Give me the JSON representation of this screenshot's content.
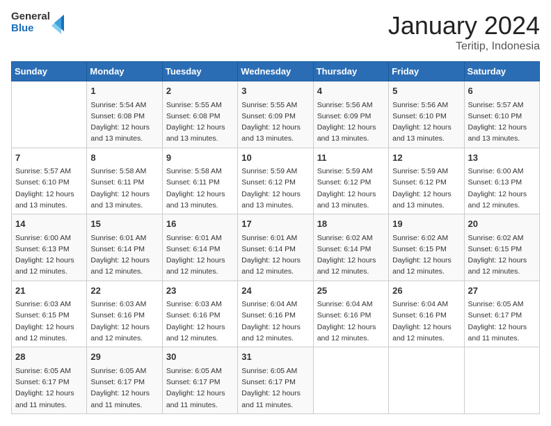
{
  "header": {
    "logo_general": "General",
    "logo_blue": "Blue",
    "month_title": "January 2024",
    "location": "Teritip, Indonesia"
  },
  "days_of_week": [
    "Sunday",
    "Monday",
    "Tuesday",
    "Wednesday",
    "Thursday",
    "Friday",
    "Saturday"
  ],
  "weeks": [
    [
      {
        "day": "",
        "sunrise": "",
        "sunset": "",
        "daylight": ""
      },
      {
        "day": "1",
        "sunrise": "Sunrise: 5:54 AM",
        "sunset": "Sunset: 6:08 PM",
        "daylight": "Daylight: 12 hours and 13 minutes."
      },
      {
        "day": "2",
        "sunrise": "Sunrise: 5:55 AM",
        "sunset": "Sunset: 6:08 PM",
        "daylight": "Daylight: 12 hours and 13 minutes."
      },
      {
        "day": "3",
        "sunrise": "Sunrise: 5:55 AM",
        "sunset": "Sunset: 6:09 PM",
        "daylight": "Daylight: 12 hours and 13 minutes."
      },
      {
        "day": "4",
        "sunrise": "Sunrise: 5:56 AM",
        "sunset": "Sunset: 6:09 PM",
        "daylight": "Daylight: 12 hours and 13 minutes."
      },
      {
        "day": "5",
        "sunrise": "Sunrise: 5:56 AM",
        "sunset": "Sunset: 6:10 PM",
        "daylight": "Daylight: 12 hours and 13 minutes."
      },
      {
        "day": "6",
        "sunrise": "Sunrise: 5:57 AM",
        "sunset": "Sunset: 6:10 PM",
        "daylight": "Daylight: 12 hours and 13 minutes."
      }
    ],
    [
      {
        "day": "7",
        "sunrise": "Sunrise: 5:57 AM",
        "sunset": "Sunset: 6:10 PM",
        "daylight": "Daylight: 12 hours and 13 minutes."
      },
      {
        "day": "8",
        "sunrise": "Sunrise: 5:58 AM",
        "sunset": "Sunset: 6:11 PM",
        "daylight": "Daylight: 12 hours and 13 minutes."
      },
      {
        "day": "9",
        "sunrise": "Sunrise: 5:58 AM",
        "sunset": "Sunset: 6:11 PM",
        "daylight": "Daylight: 12 hours and 13 minutes."
      },
      {
        "day": "10",
        "sunrise": "Sunrise: 5:59 AM",
        "sunset": "Sunset: 6:12 PM",
        "daylight": "Daylight: 12 hours and 13 minutes."
      },
      {
        "day": "11",
        "sunrise": "Sunrise: 5:59 AM",
        "sunset": "Sunset: 6:12 PM",
        "daylight": "Daylight: 12 hours and 13 minutes."
      },
      {
        "day": "12",
        "sunrise": "Sunrise: 5:59 AM",
        "sunset": "Sunset: 6:12 PM",
        "daylight": "Daylight: 12 hours and 13 minutes."
      },
      {
        "day": "13",
        "sunrise": "Sunrise: 6:00 AM",
        "sunset": "Sunset: 6:13 PM",
        "daylight": "Daylight: 12 hours and 12 minutes."
      }
    ],
    [
      {
        "day": "14",
        "sunrise": "Sunrise: 6:00 AM",
        "sunset": "Sunset: 6:13 PM",
        "daylight": "Daylight: 12 hours and 12 minutes."
      },
      {
        "day": "15",
        "sunrise": "Sunrise: 6:01 AM",
        "sunset": "Sunset: 6:14 PM",
        "daylight": "Daylight: 12 hours and 12 minutes."
      },
      {
        "day": "16",
        "sunrise": "Sunrise: 6:01 AM",
        "sunset": "Sunset: 6:14 PM",
        "daylight": "Daylight: 12 hours and 12 minutes."
      },
      {
        "day": "17",
        "sunrise": "Sunrise: 6:01 AM",
        "sunset": "Sunset: 6:14 PM",
        "daylight": "Daylight: 12 hours and 12 minutes."
      },
      {
        "day": "18",
        "sunrise": "Sunrise: 6:02 AM",
        "sunset": "Sunset: 6:14 PM",
        "daylight": "Daylight: 12 hours and 12 minutes."
      },
      {
        "day": "19",
        "sunrise": "Sunrise: 6:02 AM",
        "sunset": "Sunset: 6:15 PM",
        "daylight": "Daylight: 12 hours and 12 minutes."
      },
      {
        "day": "20",
        "sunrise": "Sunrise: 6:02 AM",
        "sunset": "Sunset: 6:15 PM",
        "daylight": "Daylight: 12 hours and 12 minutes."
      }
    ],
    [
      {
        "day": "21",
        "sunrise": "Sunrise: 6:03 AM",
        "sunset": "Sunset: 6:15 PM",
        "daylight": "Daylight: 12 hours and 12 minutes."
      },
      {
        "day": "22",
        "sunrise": "Sunrise: 6:03 AM",
        "sunset": "Sunset: 6:16 PM",
        "daylight": "Daylight: 12 hours and 12 minutes."
      },
      {
        "day": "23",
        "sunrise": "Sunrise: 6:03 AM",
        "sunset": "Sunset: 6:16 PM",
        "daylight": "Daylight: 12 hours and 12 minutes."
      },
      {
        "day": "24",
        "sunrise": "Sunrise: 6:04 AM",
        "sunset": "Sunset: 6:16 PM",
        "daylight": "Daylight: 12 hours and 12 minutes."
      },
      {
        "day": "25",
        "sunrise": "Sunrise: 6:04 AM",
        "sunset": "Sunset: 6:16 PM",
        "daylight": "Daylight: 12 hours and 12 minutes."
      },
      {
        "day": "26",
        "sunrise": "Sunrise: 6:04 AM",
        "sunset": "Sunset: 6:16 PM",
        "daylight": "Daylight: 12 hours and 12 minutes."
      },
      {
        "day": "27",
        "sunrise": "Sunrise: 6:05 AM",
        "sunset": "Sunset: 6:17 PM",
        "daylight": "Daylight: 12 hours and 11 minutes."
      }
    ],
    [
      {
        "day": "28",
        "sunrise": "Sunrise: 6:05 AM",
        "sunset": "Sunset: 6:17 PM",
        "daylight": "Daylight: 12 hours and 11 minutes."
      },
      {
        "day": "29",
        "sunrise": "Sunrise: 6:05 AM",
        "sunset": "Sunset: 6:17 PM",
        "daylight": "Daylight: 12 hours and 11 minutes."
      },
      {
        "day": "30",
        "sunrise": "Sunrise: 6:05 AM",
        "sunset": "Sunset: 6:17 PM",
        "daylight": "Daylight: 12 hours and 11 minutes."
      },
      {
        "day": "31",
        "sunrise": "Sunrise: 6:05 AM",
        "sunset": "Sunset: 6:17 PM",
        "daylight": "Daylight: 12 hours and 11 minutes."
      },
      {
        "day": "",
        "sunrise": "",
        "sunset": "",
        "daylight": ""
      },
      {
        "day": "",
        "sunrise": "",
        "sunset": "",
        "daylight": ""
      },
      {
        "day": "",
        "sunrise": "",
        "sunset": "",
        "daylight": ""
      }
    ]
  ]
}
